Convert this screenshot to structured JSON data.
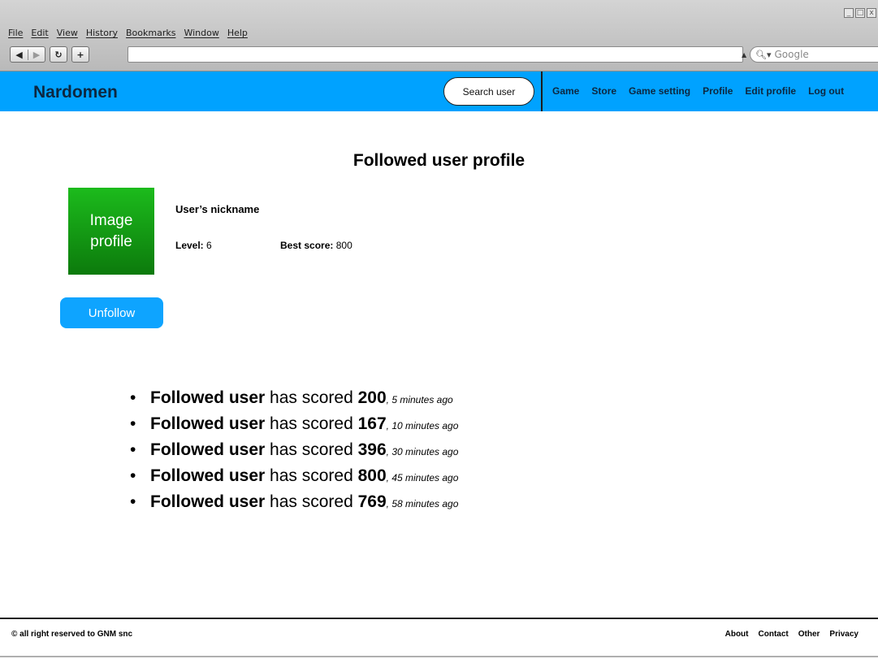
{
  "browser": {
    "menu": [
      "File",
      "Edit",
      "View",
      "History",
      "Bookmarks",
      "Window",
      "Help"
    ],
    "back_glyph": "◀",
    "forward_glyph": "▶",
    "reload_glyph": "↻",
    "add_glyph": "+",
    "url": "",
    "search_placeholder": "Google",
    "win_controls": [
      "_",
      "□",
      "x"
    ]
  },
  "header": {
    "brand": "Nardomen",
    "search_user_label": "Search user",
    "nav": [
      "Game",
      "Store",
      "Game setting",
      "Profile",
      "Edit profile",
      "Log out"
    ],
    "color": "#00a2ff"
  },
  "main": {
    "title": "Followed user profile",
    "profile_image_text_line1": "Image",
    "profile_image_text_line2": "profile",
    "nickname": "User’s nickname",
    "level_label": "Level:",
    "level_value": "6",
    "best_score_label": "Best score:",
    "best_score_value": "800",
    "unfollow_label": "Unfollow",
    "activity": [
      {
        "user": "Followed user",
        "verb": "has scored",
        "score": "200",
        "time": ", 5 minutes ago"
      },
      {
        "user": "Followed user",
        "verb": "has scored",
        "score": "167",
        "time": ", 10 minutes ago"
      },
      {
        "user": "Followed user",
        "verb": "has scored",
        "score": "396",
        "time": ", 30 minutes ago"
      },
      {
        "user": "Followed user",
        "verb": "has scored",
        "score": "800",
        "time": ", 45 minutes ago"
      },
      {
        "user": "Followed user",
        "verb": "has scored",
        "score": "769",
        "time": ", 58 minutes ago"
      }
    ]
  },
  "footer": {
    "copyright": "© all right reserved to GNM snc",
    "links": [
      "About",
      "Contact",
      "Other",
      "Privacy"
    ]
  }
}
